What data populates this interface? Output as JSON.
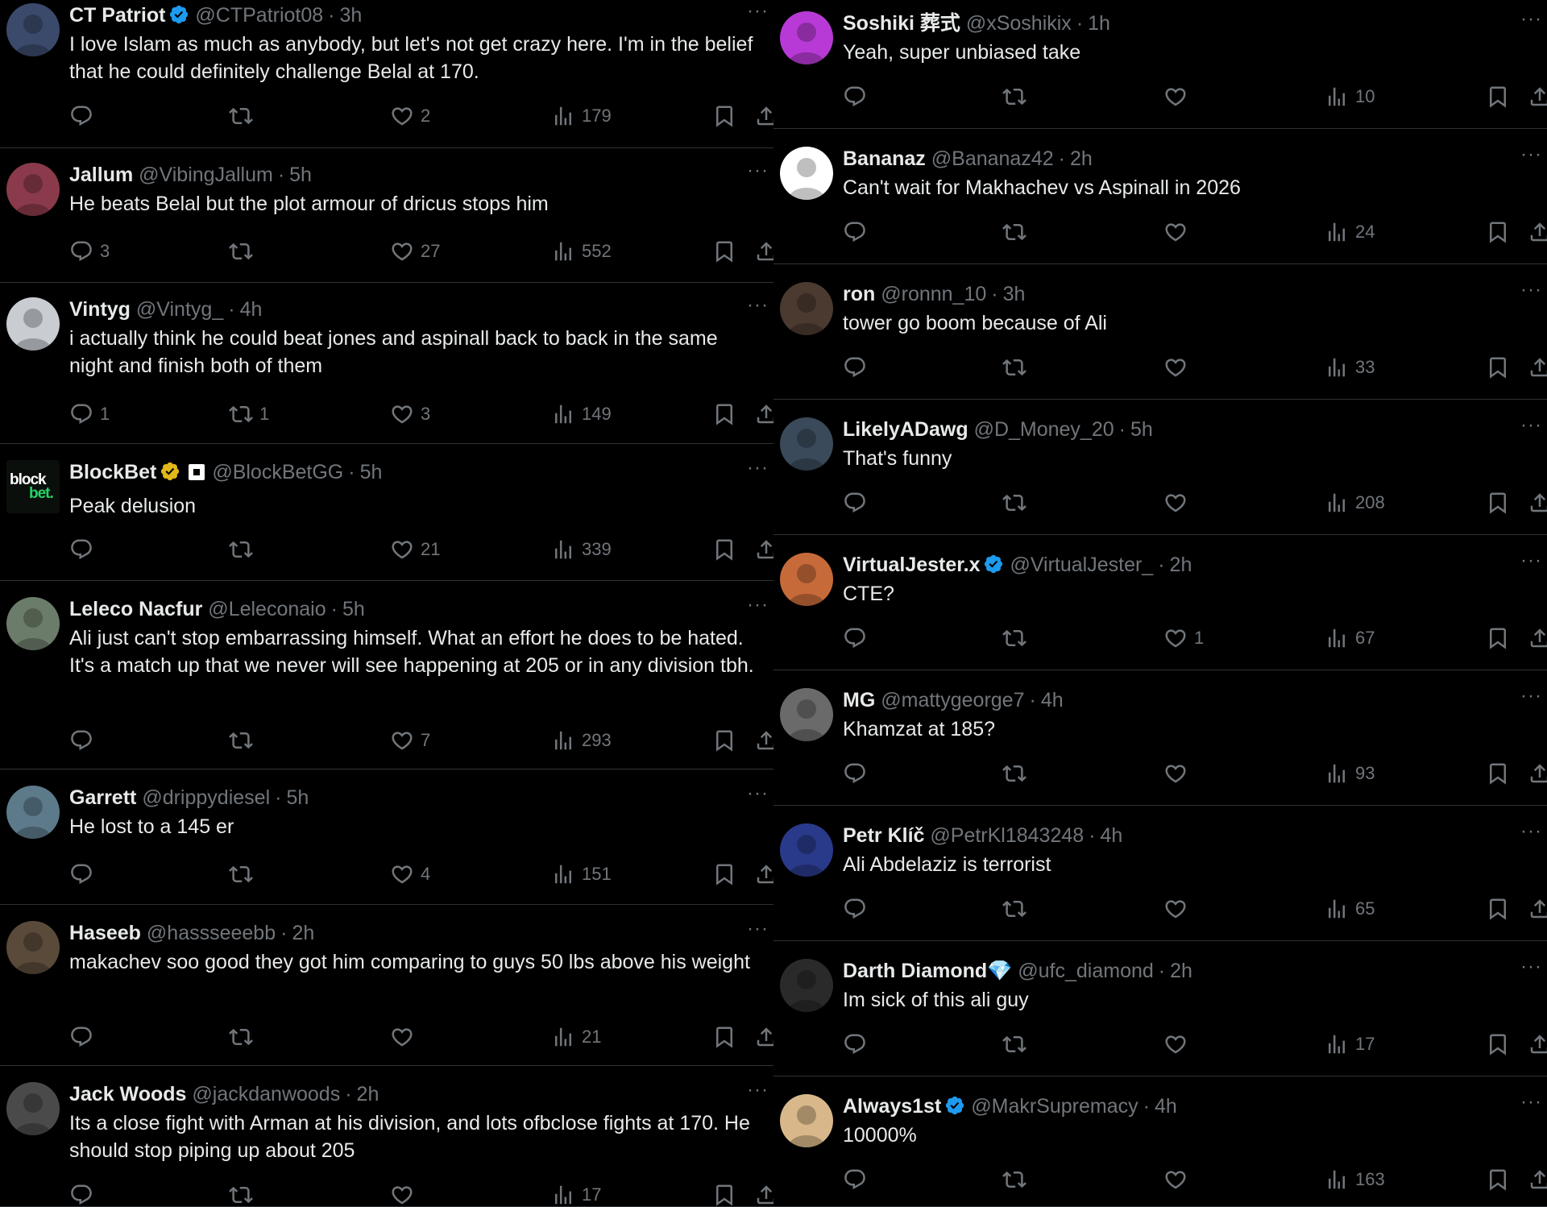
{
  "colors": {
    "background": "#000000",
    "text": "#e7e9ea",
    "muted": "#71767b",
    "verified_blue": "#1d9bf0",
    "verified_gold": "#e2b719",
    "border": "#2f3336"
  },
  "icons": {
    "reply": "reply-icon",
    "retweet": "retweet-icon",
    "like": "heart-icon",
    "views": "views-icon",
    "bookmark": "bookmark-icon",
    "share": "share-icon",
    "more": "more-icon"
  },
  "more_label": "···",
  "separator": "·",
  "left_column": [
    {
      "name": "CT Patriot",
      "badge": "blue",
      "handle": "@CTPatriot08",
      "time": "3h",
      "text": "I love Islam as much as anybody, but let's not get crazy here.  I'm in the belief that he could definitely challenge Belal at 170.",
      "replies": "",
      "retweets": "",
      "likes": "2",
      "views": "179"
    },
    {
      "name": "Jallum",
      "badge": "",
      "handle": "@VibingJallum",
      "time": "5h",
      "text": "He beats Belal but the plot armour of dricus stops him",
      "replies": "3",
      "retweets": "",
      "likes": "27",
      "views": "552"
    },
    {
      "name": "Vintyg",
      "badge": "",
      "handle": "@Vintyg_",
      "time": "4h",
      "text": "i actually think he could beat jones and aspinall back to back in the same night and finish both of them",
      "replies": "1",
      "retweets": "1",
      "likes": "3",
      "views": "149"
    },
    {
      "name": "BlockBet",
      "badge": "gold",
      "handle": "@BlockBetGG",
      "time": "5h",
      "text": "Peak delusion",
      "replies": "",
      "retweets": "",
      "likes": "21",
      "views": "339"
    },
    {
      "name": "Leleco Nacfur",
      "badge": "",
      "handle": "@Leleconaio",
      "time": "5h",
      "text": "Ali just can't stop embarrassing himself. What an effort he does to be hated. It's a match up that we never will see happening at 205 or in any division tbh.",
      "replies": "",
      "retweets": "",
      "likes": "7",
      "views": "293"
    },
    {
      "name": "Garrett",
      "badge": "",
      "handle": "@drippydiesel",
      "time": "5h",
      "text": "He lost to a 145 er",
      "replies": "",
      "retweets": "",
      "likes": "4",
      "views": "151"
    },
    {
      "name": "Haseeb",
      "badge": "",
      "handle": "@hassseeebb",
      "time": "2h",
      "text": "makachev soo good they got him comparing to guys 50 lbs above his weight",
      "replies": "",
      "retweets": "",
      "likes": "",
      "views": "21"
    },
    {
      "name": "Jack Woods",
      "badge": "",
      "handle": "@jackdanwoods",
      "time": "2h",
      "text": "Its a close fight with Arman at his division, and lots ofbclose fights at 170. He should stop piping up about 205",
      "replies": "",
      "retweets": "",
      "likes": "",
      "views": "17"
    }
  ],
  "right_column": [
    {
      "name": "Soshiki 葬式",
      "badge": "",
      "handle": "@xSoshikix",
      "time": "1h",
      "text": "Yeah, super unbiased take",
      "replies": "",
      "retweets": "",
      "likes": "",
      "views": "10"
    },
    {
      "name": "Bananaz",
      "badge": "",
      "handle": "@Bananaz42",
      "time": "2h",
      "text": "Can't wait for Makhachev vs Aspinall in 2026",
      "replies": "",
      "retweets": "",
      "likes": "",
      "views": "24"
    },
    {
      "name": "ron",
      "badge": "",
      "handle": "@ronnn_10",
      "time": "3h",
      "text": "tower go boom because of Ali",
      "replies": "",
      "retweets": "",
      "likes": "",
      "views": "33"
    },
    {
      "name": "LikelyADawg",
      "badge": "",
      "handle": "@D_Money_20",
      "time": "5h",
      "text": "That's funny",
      "replies": "",
      "retweets": "",
      "likes": "",
      "views": "208"
    },
    {
      "name": "VirtualJester.x",
      "badge": "blue",
      "handle": "@VirtualJester_",
      "time": "2h",
      "text": "CTE?",
      "replies": "",
      "retweets": "",
      "likes": "1",
      "views": "67"
    },
    {
      "name": "MG",
      "badge": "",
      "handle": "@mattygeorge7",
      "time": "4h",
      "text": "Khamzat at 185?",
      "replies": "",
      "retweets": "",
      "likes": "",
      "views": "93"
    },
    {
      "name": "Petr Klíč",
      "badge": "",
      "handle": "@PetrKl1843248",
      "time": "4h",
      "text": "Ali Abdelaziz is terrorist",
      "replies": "",
      "retweets": "",
      "likes": "",
      "views": "65"
    },
    {
      "name": "Darth Diamond💎",
      "badge": "",
      "handle": "@ufc_diamond",
      "time": "2h",
      "text": "Im sick of this ali guy",
      "replies": "",
      "retweets": "",
      "likes": "",
      "views": "17"
    },
    {
      "name": "Always1st",
      "badge": "blue",
      "handle": "@MakrSupremacy",
      "time": "4h",
      "text": "10000%",
      "replies": "",
      "retweets": "",
      "likes": "",
      "views": "163"
    }
  ],
  "blockbet_logo": {
    "line1": "block",
    "line2": "bet."
  }
}
